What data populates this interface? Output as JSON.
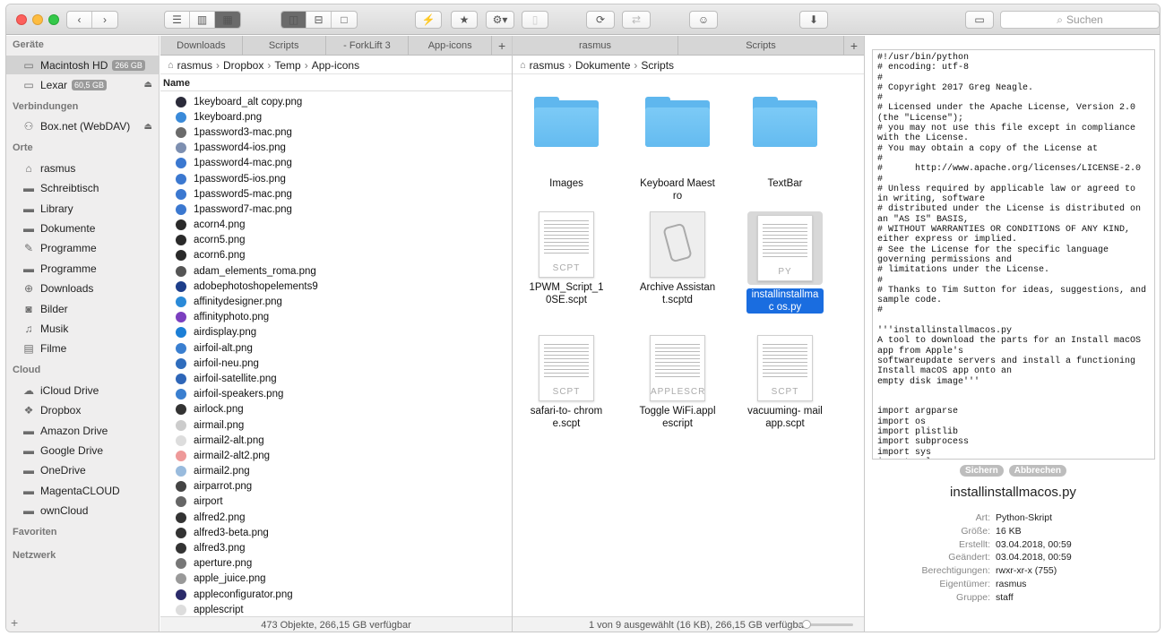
{
  "toolbar": {
    "search_placeholder": "Suchen"
  },
  "sidebar": {
    "sections": [
      {
        "title": "Geräte",
        "items": [
          {
            "label": "Macintosh HD",
            "badge": "266 GB",
            "icon": "hdd-icon",
            "selected": true
          },
          {
            "label": "Lexar",
            "badge": "60,5 GB",
            "icon": "external-drive-icon",
            "eject": true
          }
        ]
      },
      {
        "title": "Verbindungen",
        "items": [
          {
            "label": "Box.net (WebDAV)",
            "icon": "network-icon",
            "eject": true
          }
        ]
      },
      {
        "title": "Orte",
        "items": [
          {
            "label": "rasmus",
            "icon": "home-icon"
          },
          {
            "label": "Schreibtisch",
            "icon": "desktop-folder-icon"
          },
          {
            "label": "Library",
            "icon": "folder-icon"
          },
          {
            "label": "Dokumente",
            "icon": "documents-folder-icon"
          },
          {
            "label": "Programme",
            "icon": "applications-icon"
          },
          {
            "label": "Programme",
            "icon": "folder-icon"
          },
          {
            "label": "Downloads",
            "icon": "downloads-icon"
          },
          {
            "label": "Bilder",
            "icon": "pictures-icon"
          },
          {
            "label": "Musik",
            "icon": "music-icon"
          },
          {
            "label": "Filme",
            "icon": "movies-icon"
          }
        ]
      },
      {
        "title": "Cloud",
        "items": [
          {
            "label": "iCloud Drive",
            "icon": "cloud-icon"
          },
          {
            "label": "Dropbox",
            "icon": "dropbox-icon"
          },
          {
            "label": "Amazon Drive",
            "icon": "folder-icon"
          },
          {
            "label": "Google Drive",
            "icon": "folder-icon"
          },
          {
            "label": "OneDrive",
            "icon": "folder-icon"
          },
          {
            "label": "MagentaCLOUD",
            "icon": "folder-icon"
          },
          {
            "label": "ownCloud",
            "icon": "folder-icon"
          }
        ]
      },
      {
        "title": "Favoriten",
        "items": []
      },
      {
        "title": "Netzwerk",
        "items": []
      }
    ]
  },
  "left_pane": {
    "tabs": [
      "Downloads",
      "Scripts",
      "- ForkLift 3",
      "App-icons"
    ],
    "breadcrumb": [
      "rasmus",
      "Dropbox",
      "Temp",
      "App-icons"
    ],
    "column_header": "Name",
    "files": [
      "1keyboard_alt copy.png",
      "1keyboard.png",
      "1password3-mac.png",
      "1password4-ios.png",
      "1password4-mac.png",
      "1password5-ios.png",
      "1password5-mac.png",
      "1password7-mac.png",
      "acorn4.png",
      "acorn5.png",
      "acorn6.png",
      "adam_elements_roma.png",
      "adobephotoshopelements9",
      "affinitydesigner.png",
      "affinityphoto.png",
      "airdisplay.png",
      "airfoil-alt.png",
      "airfoil-neu.png",
      "airfoil-satellite.png",
      "airfoil-speakers.png",
      "airlock.png",
      "airmail.png",
      "airmail2-alt.png",
      "airmail2-alt2.png",
      "airmail2.png",
      "airparrot.png",
      "airport",
      "alfred2.png",
      "alfred3-beta.png",
      "alfred3.png",
      "aperture.png",
      "apple_juice.png",
      "appleconfigurator.png",
      "applescript"
    ],
    "status": "473 Objekte, 266,15 GB verfügbar"
  },
  "right_pane": {
    "tabs": [
      "rasmus",
      "Scripts"
    ],
    "breadcrumb": [
      "rasmus",
      "Dokumente",
      "Scripts"
    ],
    "items": [
      {
        "name": "Images",
        "kind": "folder"
      },
      {
        "name": "Keyboard Maestro",
        "kind": "folder"
      },
      {
        "name": "TextBar",
        "kind": "folder"
      },
      {
        "name": "1PWM_Script_1 0SE.scpt",
        "kind": "doc",
        "ext": "SCPT"
      },
      {
        "name": "Archive Assistant.scptd",
        "kind": "bundle"
      },
      {
        "name": "installinstallmac os.py",
        "kind": "doc",
        "ext": "PY",
        "selected": true
      },
      {
        "name": "safari-to- chrome.scpt",
        "kind": "doc",
        "ext": "SCPT"
      },
      {
        "name": "Toggle WiFi.applescript",
        "kind": "doc",
        "ext": "APPLESCRIPT"
      },
      {
        "name": "vacuuming- mailapp.scpt",
        "kind": "doc",
        "ext": "SCPT"
      }
    ],
    "status": "1 von 9 ausgewählt (16 KB), 266,15 GB verfügbar",
    "zoom_level": 0.1
  },
  "preview": {
    "code": "#!/usr/bin/python\n# encoding: utf-8\n#\n# Copyright 2017 Greg Neagle.\n#\n# Licensed under the Apache License, Version 2.0 (the \"License\");\n# you may not use this file except in compliance with the License.\n# You may obtain a copy of the License at\n#\n#      http://www.apache.org/licenses/LICENSE-2.0\n#\n# Unless required by applicable law or agreed to in writing, software\n# distributed under the License is distributed on an \"AS IS\" BASIS,\n# WITHOUT WARRANTIES OR CONDITIONS OF ANY KIND, either express or implied.\n# See the License for the specific language governing permissions and\n# limitations under the License.\n#\n# Thanks to Tim Sutton for ideas, suggestions, and sample code.\n#\n\n'''installinstallmacos.py\nA tool to download the parts for an Install macOS app from Apple's\nsoftwareupdate servers and install a functioning Install macOS app onto an\nempty disk image'''\n\n\nimport argparse\nimport os\nimport plistlib\nimport subprocess\nimport sys\nimport urlparse",
    "save_label": "Sichern",
    "cancel_label": "Abbrechen",
    "filename": "installinstallmacos.py",
    "meta": [
      {
        "k": "Art:",
        "v": "Python-Skript"
      },
      {
        "k": "Größe:",
        "v": "16 KB"
      },
      {
        "k": "Erstellt:",
        "v": "03.04.2018, 00:59"
      },
      {
        "k": "Geändert:",
        "v": "03.04.2018, 00:59"
      },
      {
        "k": "Berechtigungen:",
        "v": "rwxr-xr-x (755)"
      },
      {
        "k": "Eigentümer:",
        "v": "rasmus"
      },
      {
        "k": "Gruppe:",
        "v": "staff"
      }
    ]
  }
}
